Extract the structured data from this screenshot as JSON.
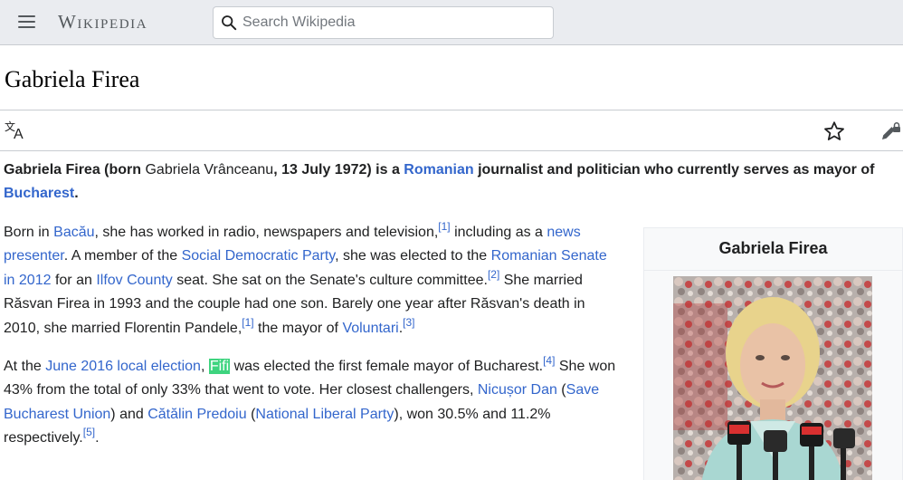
{
  "header": {
    "wordmark": "Wikipedia",
    "search_placeholder": "Search Wikipedia",
    "search_value": ""
  },
  "page": {
    "title": "Gabriela Firea"
  },
  "lead": {
    "t1": "Gabriela Firea (born ",
    "t2": "Gabriela Vrânceanu",
    "t3": ", 13 July 1972) is a ",
    "l1": "Romanian",
    "t4": " journalist and politician who currently serves as mayor of ",
    "l2": "Bucharest",
    "t5": "."
  },
  "p1": {
    "t1": "Born in ",
    "l1": "Bacău",
    "t2": ", she has worked in radio, newspapers and television,",
    "r1": "[1]",
    "t3": " including as a ",
    "l2": "news presenter",
    "t4": ". A member of the ",
    "l3": "Social Democratic Party",
    "t5": ", she was elected to the ",
    "l4": "Romanian Senate in 2012",
    "t6": " for an ",
    "l5": "Ilfov County",
    "t7": " seat. She sat on the Senate's culture committee.",
    "r2": "[2]",
    "t8": " She married Răsvan Firea in 1993 and the couple had one son. Barely one year after Răsvan's death in 2010, she married Florentin Pandele,",
    "r3": "[1]",
    "t9": " the mayor of ",
    "l6": "Voluntari",
    "t10": ".",
    "r4": "[3]"
  },
  "p2": {
    "t1": "At the ",
    "l1": "June 2016 local election",
    "t2": ", ",
    "hl": "Fifi",
    "t3": " was elected the first female mayor of Bucharest.",
    "r1": "[4]",
    "t4": " She won 43% from the total of only 33% that went to vote. Her closest challengers, ",
    "l2": "Nicușor Dan",
    "t5": " (",
    "l3": "Save Bucharest Union",
    "t6": ") and ",
    "l4": "Cătălin Predoiu",
    "t7": " (",
    "l5": "National Liberal Party",
    "t8": "), won 30.5% and 11.2% respectively.",
    "r2": "[5]",
    "t9": "."
  },
  "infobox": {
    "title": "Gabriela Firea"
  },
  "icons": {
    "menu": "hamburger-menu-icon",
    "search": "search-icon",
    "language": "language-translate-icon",
    "watch": "star-icon",
    "edit": "edit-lock-icon"
  },
  "colors": {
    "link": "#3366cc",
    "header_bg": "#eaecf0",
    "highlight": "#3ed47f",
    "text": "#202122"
  }
}
